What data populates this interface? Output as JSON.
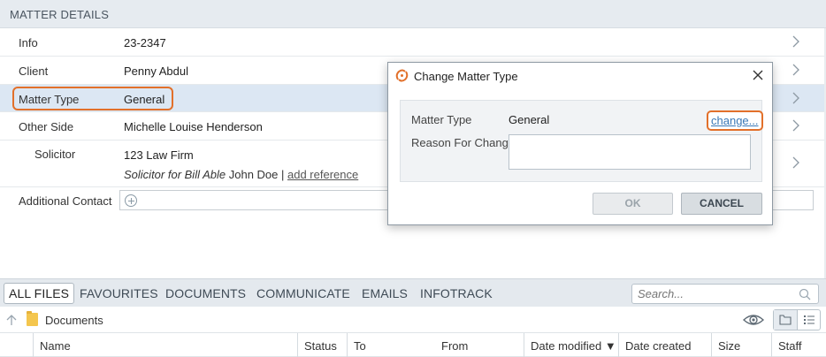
{
  "section": {
    "title": "MATTER DETAILS"
  },
  "rows": {
    "info": {
      "label": "Info",
      "value": "23-2347"
    },
    "client": {
      "label": "Client",
      "value": "Penny Abdul"
    },
    "matter_type": {
      "label": "Matter Type",
      "value": "General"
    },
    "other_side": {
      "label": "Other Side",
      "value": "Michelle Louise Henderson"
    },
    "solicitor": {
      "label": "Solicitor",
      "firm": "123 Law Firm",
      "role_italic": "Solicitor for Bill Able",
      "person": " John Doe | ",
      "add_reference": "add reference"
    },
    "additional_contact": {
      "label": "Additional Contact"
    }
  },
  "dialog": {
    "title": "Change Matter Type",
    "matter_type_label": "Matter Type",
    "matter_type_value": "General",
    "change_link": "change...",
    "reason_label": "Reason For Change",
    "reason_value": "",
    "ok_label": "OK",
    "cancel_label": "CANCEL"
  },
  "tabs": [
    {
      "label": "ALL FILES",
      "active": true
    },
    {
      "label": "FAVOURITES"
    },
    {
      "label": "DOCUMENTS"
    },
    {
      "label": "COMMUNICATE"
    },
    {
      "label": "EMAILS"
    },
    {
      "label": "INFOTRACK"
    }
  ],
  "search": {
    "placeholder": "Search..."
  },
  "path": {
    "current": "Documents"
  },
  "columns": [
    {
      "label": ""
    },
    {
      "label": "Name"
    },
    {
      "label": "Status"
    },
    {
      "label": "To"
    },
    {
      "label": "From"
    },
    {
      "label": "Date modified ▼"
    },
    {
      "label": "Date created"
    },
    {
      "label": "Size"
    },
    {
      "label": "Staff"
    }
  ],
  "colors": {
    "highlight": "#e2702a",
    "selected_row": "#dce7f3",
    "link": "#3a78b6"
  },
  "icons": [
    "chevron-right-icon",
    "plus-circle-icon",
    "search-icon",
    "up-arrow-icon",
    "folder-icon",
    "eye-icon",
    "folder-view-icon",
    "list-view-icon",
    "close-icon",
    "app-logo-icon"
  ]
}
